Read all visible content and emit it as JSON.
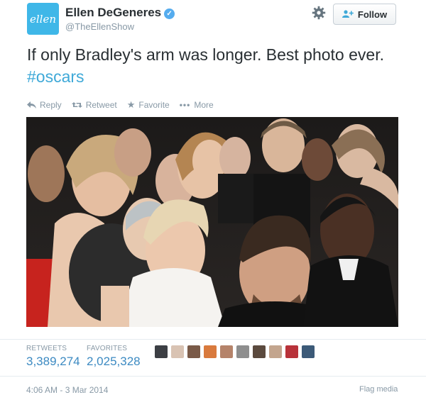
{
  "tweet": {
    "avatar_text": "ellen",
    "name": "Ellen DeGeneres",
    "handle": "@TheEllenShow",
    "follow_label": "Follow",
    "text_main": "If only Bradley's arm was longer. Best photo ever. ",
    "hashtag": "#oscars",
    "accent_color": "#55acee"
  },
  "actions": [
    {
      "label": "Reply",
      "icon": "reply-icon"
    },
    {
      "label": "Retweet",
      "icon": "retweet-icon"
    },
    {
      "label": "Favorite",
      "icon": "star-icon"
    },
    {
      "label": "More",
      "icon": "more-dots-icon"
    }
  ],
  "stats": {
    "retweets_label": "RETWEETS",
    "retweets_value": "3,389,274",
    "favorites_label": "FAVORITES",
    "favorites_value": "2,025,328"
  },
  "footer": {
    "timestamp": "4:06 AM - 3 Mar 2014",
    "flag_label": "Flag media"
  }
}
